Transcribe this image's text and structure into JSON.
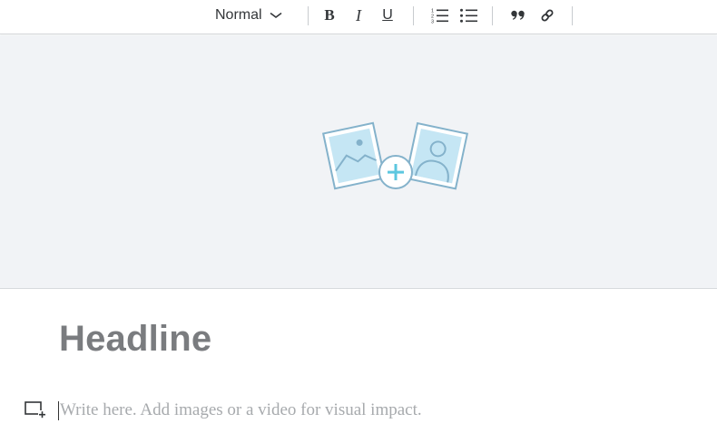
{
  "toolbar": {
    "text_style": {
      "value": "Normal",
      "icon": "chevron-down-icon"
    },
    "buttons": {
      "bold": "B",
      "italic": "I",
      "underline": "U",
      "ordered_list": "ordered-list-icon",
      "bullet_list": "bullet-list-icon",
      "blockquote": "quote-icon",
      "link": "link-icon"
    }
  },
  "media": {
    "icon": "add-images-icon"
  },
  "editor": {
    "headline": "Headline",
    "body_placeholder": "Write here. Add images or a video for visual impact.",
    "add_media_icon": "add-media-icon"
  },
  "colors": {
    "toolbar_bg": "#ffffff",
    "media_bg": "#f1f3f6",
    "illustration_stroke": "#84b2cb",
    "illustration_fill": "#c5e6f4",
    "illustration_accent": "#5cc7df",
    "headline": "#7a7c7f",
    "placeholder": "#a7aaad"
  }
}
